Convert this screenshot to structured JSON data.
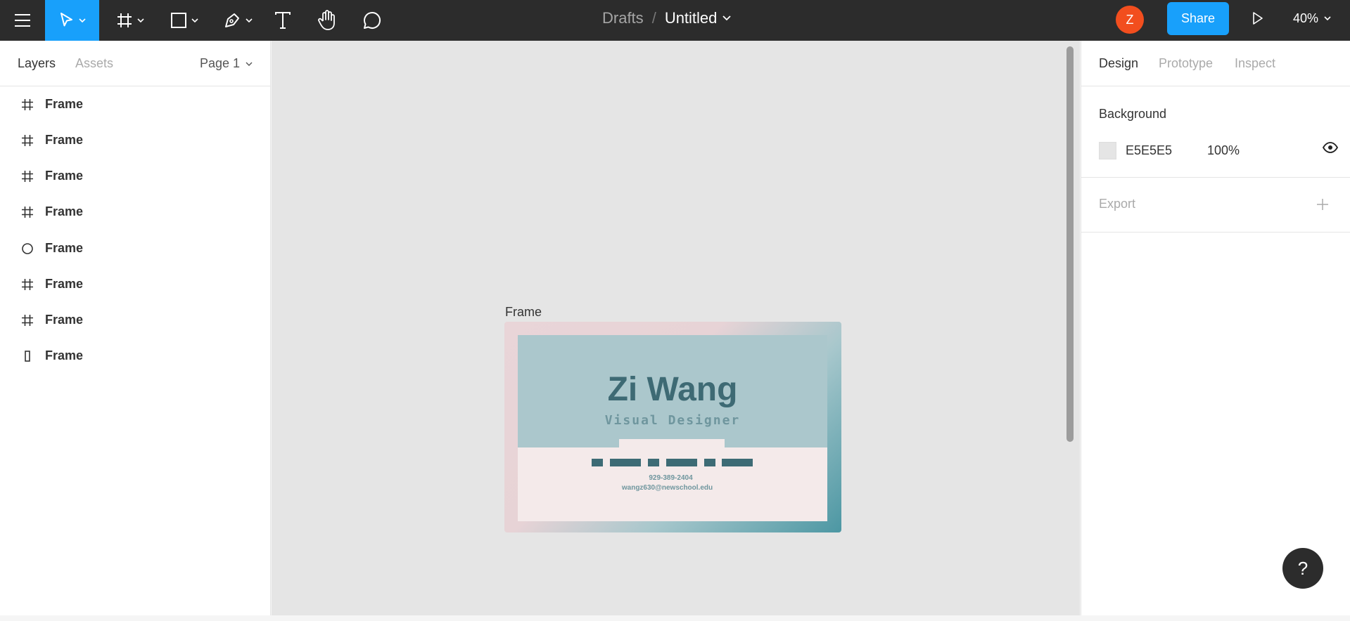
{
  "toolbar": {
    "breadcrumb_parent": "Drafts",
    "breadcrumb_sep": "/",
    "file_title": "Untitled",
    "avatar_initial": "Z",
    "share_label": "Share",
    "zoom_level": "40%",
    "icons": [
      "menu-icon",
      "move-icon",
      "frame-icon",
      "rectangle-icon",
      "pen-icon",
      "text-icon",
      "hand-icon",
      "comment-icon",
      "play-icon"
    ]
  },
  "left_panel": {
    "tab_layers": "Layers",
    "tab_assets": "Assets",
    "page_selector": "Page 1",
    "layers": [
      {
        "name": "Frame",
        "icon": "frame-icon"
      },
      {
        "name": "Frame",
        "icon": "frame-icon"
      },
      {
        "name": "Frame",
        "icon": "frame-icon"
      },
      {
        "name": "Frame",
        "icon": "frame-icon"
      },
      {
        "name": "Frame",
        "icon": "ellipse-icon"
      },
      {
        "name": "Frame",
        "icon": "frame-icon"
      },
      {
        "name": "Frame",
        "icon": "frame-icon"
      },
      {
        "name": "Frame",
        "icon": "rectangle-icon"
      }
    ]
  },
  "canvas": {
    "frame_label": "Frame",
    "card": {
      "name": "Zi Wang",
      "role": "Visual Designer",
      "phone": "929-389-2404",
      "email": "wangz630@newschool.edu"
    }
  },
  "right_panel": {
    "tab_design": "Design",
    "tab_prototype": "Prototype",
    "tab_inspect": "Inspect",
    "background_title": "Background",
    "background_hex": "E5E5E5",
    "background_opacity": "100%",
    "export_title": "Export"
  },
  "help_label": "?",
  "colors": {
    "toolbar_bg": "#2c2c2c",
    "accent": "#18a0fb",
    "avatar": "#f24e1e",
    "canvas_bg": "#e5e5e5"
  }
}
